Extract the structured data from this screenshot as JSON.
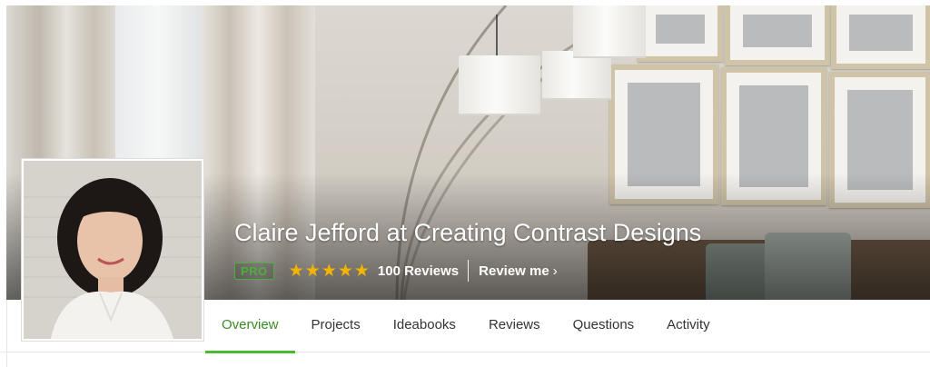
{
  "profile": {
    "name": "Claire Jefford at Creating Contrast Designs",
    "badge": "PRO",
    "rating": 5,
    "reviews_count": "100 Reviews",
    "review_cta": "Review me",
    "review_cta_icon": "chevron-right-icon"
  },
  "tabs": [
    {
      "label": "Overview",
      "active": true
    },
    {
      "label": "Projects",
      "active": false
    },
    {
      "label": "Ideabooks",
      "active": false
    },
    {
      "label": "Reviews",
      "active": false
    },
    {
      "label": "Questions",
      "active": false
    },
    {
      "label": "Activity",
      "active": false
    }
  ],
  "colors": {
    "accent": "#4dbb2f",
    "star": "#f4b400"
  }
}
